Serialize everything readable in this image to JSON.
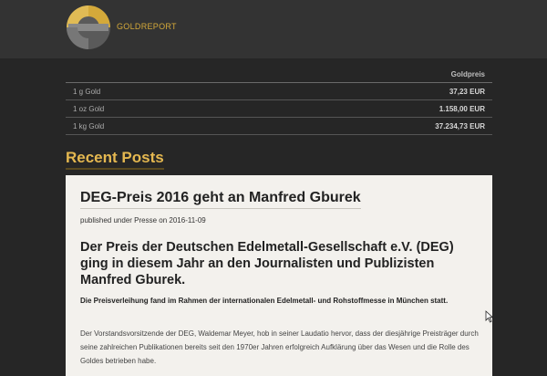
{
  "brand": {
    "name": "GOLDREPORT",
    "logo": "goldreport-logo-icon",
    "accent": "#d4a93a"
  },
  "price_table": {
    "header": "Goldpreis",
    "rows": [
      {
        "label": "1 g Gold",
        "price": "37,23 EUR"
      },
      {
        "label": "1 oz Gold",
        "price": "1.158,00 EUR"
      },
      {
        "label": "1 kg Gold",
        "price": "37.234,73 EUR"
      }
    ]
  },
  "recent_posts": {
    "title": "Recent Posts"
  },
  "post": {
    "title": "DEG-Preis 2016 geht an Manfred Gburek",
    "meta": "published under Presse on 2016-11-09",
    "lead": "Der Preis der Deutschen Edelmetall-Gesellschaft e.V. (DEG) ging in diesem Jahr an den Journalisten und Publizisten Manfred Gburek.",
    "subhead": "Die Preisverleihung fand im Rahmen der internationalen Edelmetall- und Rohstoffmesse in München statt.",
    "body": "Der Vorstandsvorsitzende der DEG, Waldemar Meyer, hob in seiner Laudatio hervor, dass der diesjährige Preisträger durch seine zahlreichen Publikationen bereits seit den 1970er Jahren erfolgreich Aufklärung über das Wesen und die Rolle des Goldes betrieben habe."
  }
}
